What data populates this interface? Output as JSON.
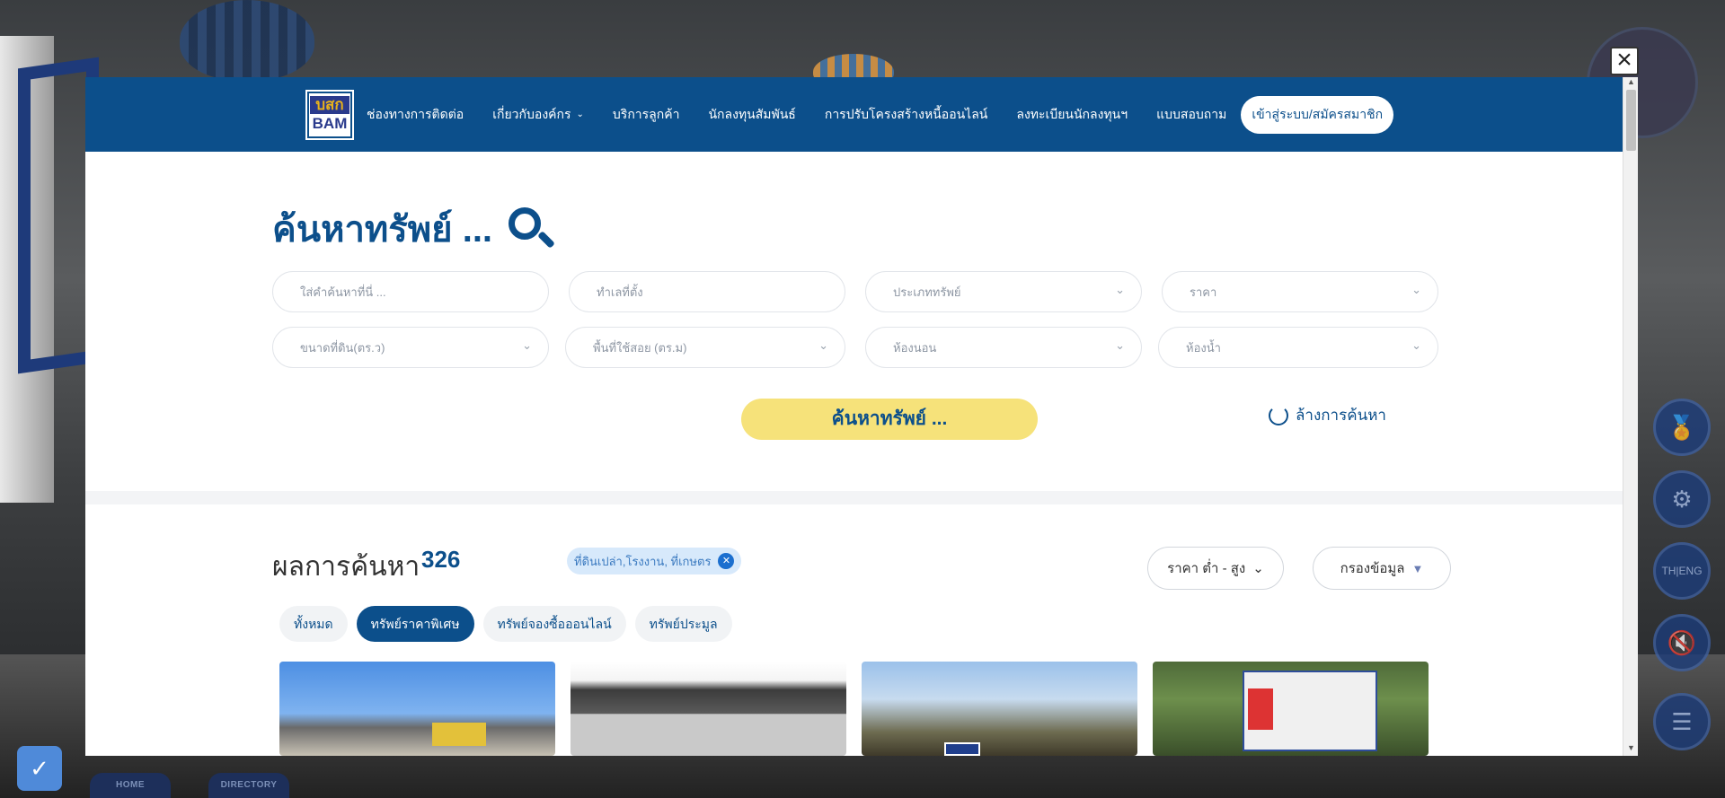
{
  "navbar": {
    "logo_top": "บสก",
    "logo_bottom": "BAM",
    "items": [
      {
        "label": "ช่องทางการติดต่อ"
      },
      {
        "label": "เกี่ยวกับองค์กร",
        "has_dropdown": true
      },
      {
        "label": "บริการลูกค้า"
      },
      {
        "label": "นักลงทุนสัมพันธ์"
      },
      {
        "label": "การปรับโครงสร้างหนี้ออนไลน์"
      },
      {
        "label": "ลงทะเบียนนักลงทุนฯ"
      },
      {
        "label": "แบบสอบถาม"
      }
    ],
    "login_label": "เข้าสู่ระบบ/สมัครสมาชิก"
  },
  "search": {
    "title": "ค้นหาทรัพย์ ...",
    "keyword_placeholder": "ใส่คำค้นหาที่นี่ ...",
    "location_placeholder": "ทำเลที่ตั้ง",
    "property_type": "ประเภททรัพย์",
    "price": "ราคา",
    "land_size": "ขนาดที่ดิน(ตร.ว)",
    "usable_area": "พื้นที่ใช้สอย (ตร.ม)",
    "bedrooms": "ห้องนอน",
    "bathrooms": "ห้องน้ำ",
    "submit_label": "ค้นหาทรัพย์ ...",
    "clear_label": "ล้างการค้นหา"
  },
  "results": {
    "title": "ผลการค้นหา",
    "count": "326",
    "filter_chip": "ที่ดินเปล่า,โรงงาน, ที่เกษตร",
    "sort_label": "ราคา ต่ำ - สูง",
    "filter_label": "กรองข้อมูล",
    "tabs": [
      {
        "label": "ทั้งหมด",
        "active": false
      },
      {
        "label": "ทรัพย์ราคาพิเศษ",
        "active": true
      },
      {
        "label": "ทรัพย์จองซื้อออนไลน์",
        "active": false
      },
      {
        "label": "ทรัพย์ประมูล",
        "active": false
      }
    ]
  },
  "background": {
    "bottom_tabs": [
      "HOME",
      "DIRECTORY"
    ]
  },
  "colors": {
    "brand_blue": "#0c4f8b",
    "accent_yellow": "#f6e27a",
    "chip_bg": "#d7e9fb"
  },
  "icons": [
    "search-icon",
    "chevron-down-icon",
    "close-icon",
    "refresh-icon",
    "filter-icon",
    "shield-icon",
    "gear-icon",
    "mute-icon",
    "list-icon"
  ]
}
